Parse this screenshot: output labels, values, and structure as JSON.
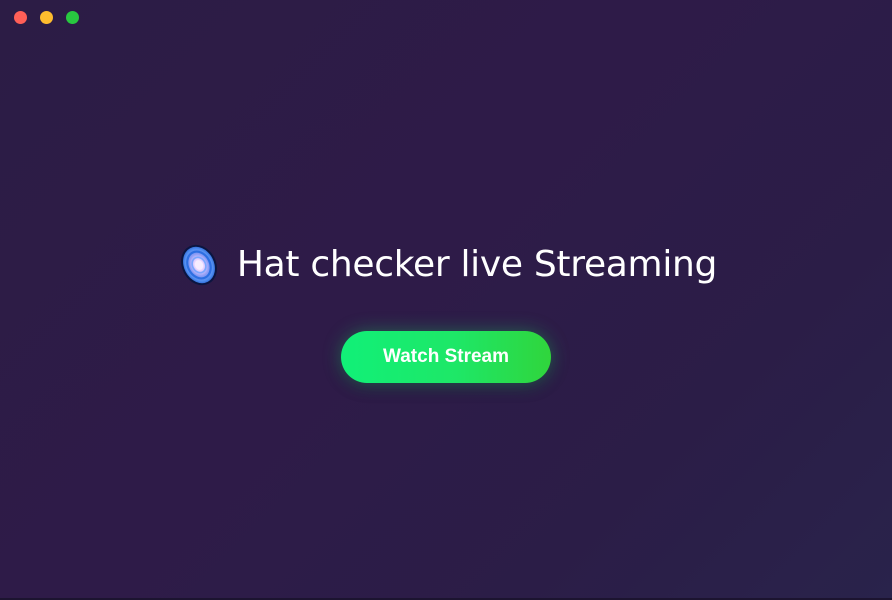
{
  "window": {
    "controls": {
      "close_icon": "close-traffic-light",
      "minimize_icon": "minimize-traffic-light",
      "zoom_icon": "zoom-traffic-light"
    },
    "colors": {
      "close": "#ff5f57",
      "minimize": "#febc2e",
      "zoom": "#28c840"
    }
  },
  "hero": {
    "logo_icon": "galaxy-orb-icon",
    "title": "Hat checker live Streaming"
  },
  "cta": {
    "label": "Watch Stream",
    "accent_color": "#1ee767"
  },
  "theme": {
    "background": "#2e1b48",
    "text": "#ffffff"
  }
}
